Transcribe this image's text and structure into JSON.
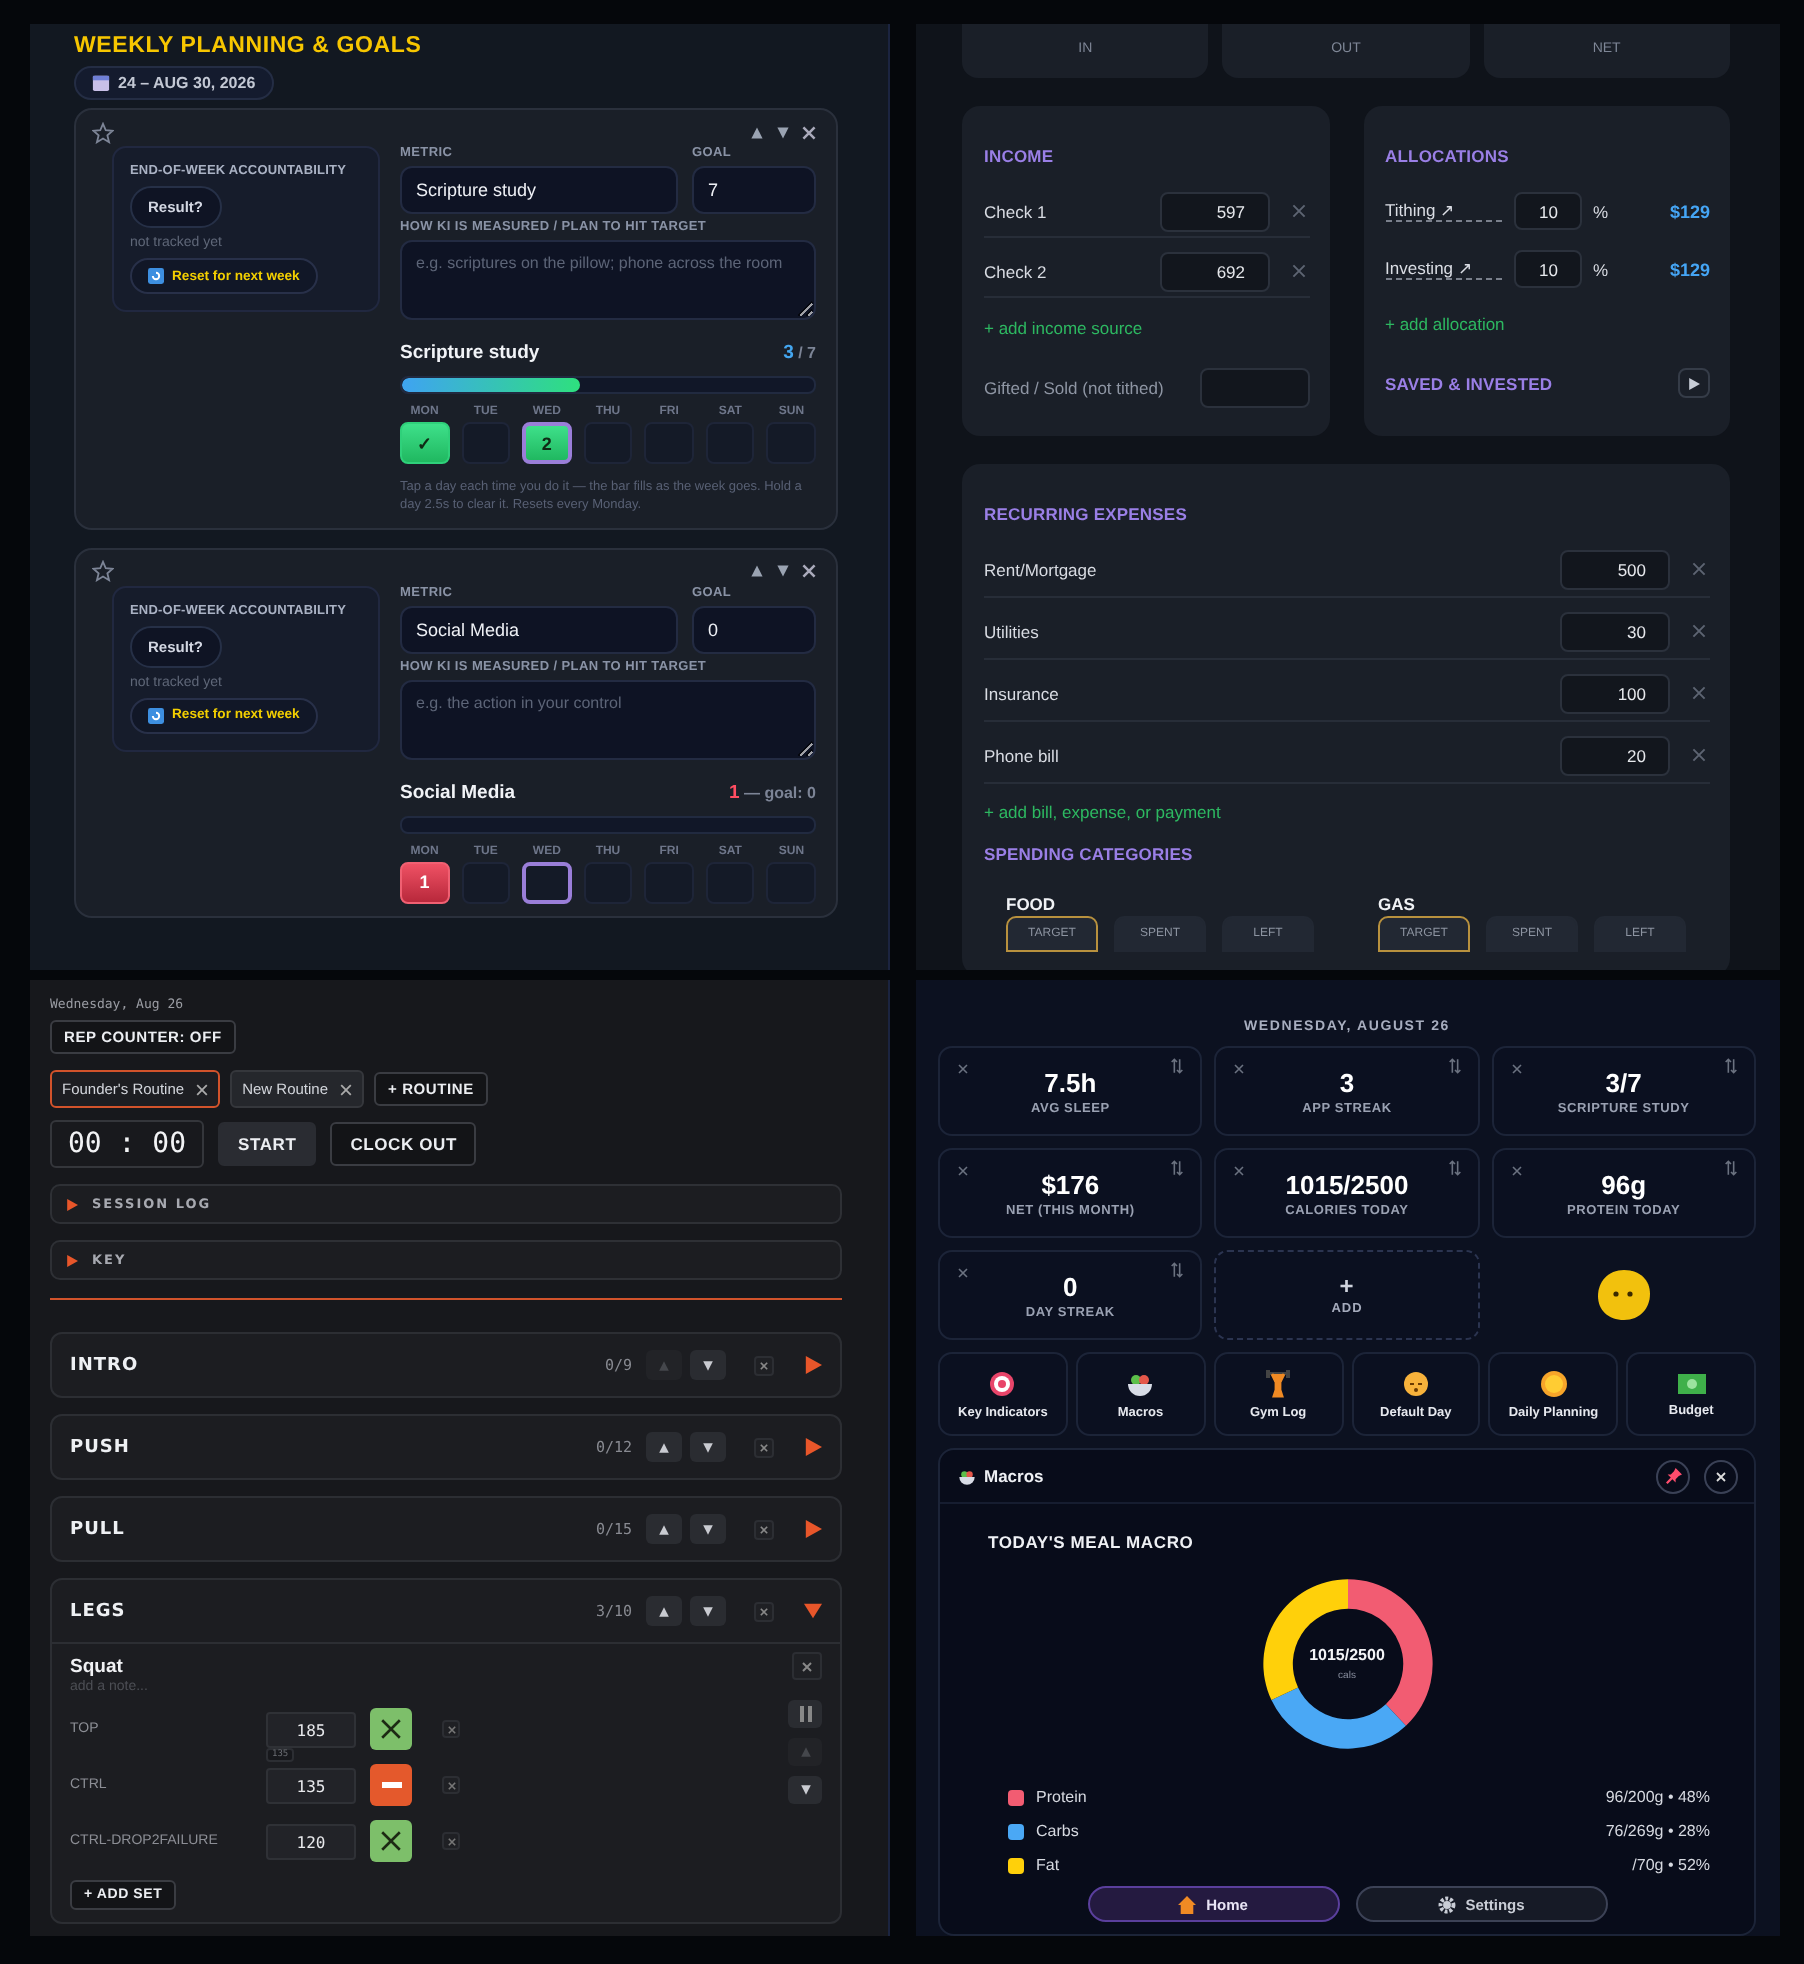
{
  "planning": {
    "title": "WEEKLY PLANNING & GOALS",
    "date_range": "24 – AUG 30, 2026",
    "goals": [
      {
        "starred": false,
        "accountability_label": "END-OF-WEEK ACCOUNTABILITY",
        "result_button": "Result?",
        "tracking_status": "not tracked yet",
        "reset_button": "Reset for next week",
        "metric_label": "METRIC",
        "metric": "Scripture study",
        "goal_label": "GOAL",
        "goal": "7",
        "plan_label": "HOW KI IS MEASURED / PLAN TO HIT TARGET",
        "plan_placeholder": "e.g. scriptures on the pillow; phone across the room",
        "progress_title": "Scripture study",
        "count": "3",
        "count_suffix": "/ 7",
        "over_goal": false,
        "level": 0.43,
        "days": [
          {
            "label": "MON",
            "mark": "✓",
            "checked": true,
            "today": false
          },
          {
            "label": "TUE",
            "checked": false,
            "today": false
          },
          {
            "label": "WED",
            "mark": "2",
            "checked": true,
            "today": true
          },
          {
            "label": "THU",
            "checked": false,
            "today": false
          },
          {
            "label": "FRI",
            "checked": false,
            "today": false
          },
          {
            "label": "SAT",
            "checked": false,
            "today": false
          },
          {
            "label": "SUN",
            "checked": false,
            "today": false
          }
        ],
        "hint": "Tap a day each time you do it — the bar fills as the week goes. Hold a day 2.5s to clear it. Resets every Monday."
      },
      {
        "starred": false,
        "accountability_label": "END-OF-WEEK ACCOUNTABILITY",
        "result_button": "Result?",
        "tracking_status": "not tracked yet",
        "reset_button": "Reset for next week",
        "metric_label": "METRIC",
        "metric": "Social Media",
        "goal_label": "GOAL",
        "goal": "0",
        "plan_label": "HOW KI IS MEASURED / PLAN TO HIT TARGET",
        "plan_placeholder": "e.g. the action in your control",
        "progress_title": "Social Media",
        "count": "1",
        "count_suffix": "— goal: 0",
        "over_goal": true,
        "level": 0,
        "days": [
          {
            "label": "MON",
            "mark": "1",
            "checked": true,
            "today": false
          },
          {
            "label": "TUE",
            "checked": false,
            "today": false
          },
          {
            "label": "WED",
            "checked": false,
            "today": true
          },
          {
            "label": "THU",
            "checked": false,
            "today": false
          },
          {
            "label": "FRI",
            "checked": false,
            "today": false
          },
          {
            "label": "SAT",
            "checked": false,
            "today": false
          },
          {
            "label": "SUN",
            "checked": false,
            "today": false
          }
        ]
      }
    ]
  },
  "budget": {
    "summary": [
      "IN",
      "OUT",
      "NET"
    ],
    "income": {
      "title": "INCOME",
      "sources": [
        {
          "name": "Check 1",
          "amount": "597"
        },
        {
          "name": "Check 2",
          "amount": "692"
        }
      ],
      "add_label": "+ add income source",
      "gifted_label": "Gifted / Sold (not tithed)"
    },
    "allocations": {
      "title": "ALLOCATIONS",
      "items": [
        {
          "name": "Tithing ↗",
          "percent": "10",
          "unit": "%",
          "amount": "$129"
        },
        {
          "name": "Investing ↗",
          "percent": "10",
          "unit": "%",
          "amount": "$129"
        }
      ],
      "add_label": "+ add allocation",
      "saved_title": "SAVED & INVESTED"
    },
    "expenses": {
      "title": "RECURRING EXPENSES",
      "items": [
        {
          "name": "Rent/Mortgage",
          "amount": "500"
        },
        {
          "name": "Utilities",
          "amount": "30"
        },
        {
          "name": "Insurance",
          "amount": "100"
        },
        {
          "name": "Phone bill",
          "amount": "20"
        }
      ],
      "add_label": "+ add bill, expense, or payment"
    },
    "spending": {
      "title": "SPENDING CATEGORIES",
      "categories": [
        {
          "name": "FOOD",
          "tabs": [
            {
              "label": "TARGET",
              "selected": true
            },
            {
              "label": "SPENT",
              "selected": false
            },
            {
              "label": "LEFT",
              "selected": false
            }
          ]
        },
        {
          "name": "GAS",
          "tabs": [
            {
              "label": "TARGET",
              "selected": true
            },
            {
              "label": "SPENT",
              "selected": false
            },
            {
              "label": "LEFT",
              "selected": false
            }
          ]
        }
      ]
    }
  },
  "gym": {
    "date": "Wednesday, Aug 26",
    "rep_counter": "REP COUNTER: OFF",
    "routines": [
      {
        "name": "Founder's Routine",
        "selected": true
      },
      {
        "name": "New Routine",
        "selected": false
      }
    ],
    "add_routine": "+ ROUTINE",
    "timer": "00 : 00",
    "start": "START",
    "clock_out": "CLOCK OUT",
    "panels": [
      "SESSION LOG",
      "KEY"
    ],
    "sections": [
      {
        "name": "INTRO",
        "progress": "0/9",
        "up_disabled": true,
        "expanded": false
      },
      {
        "name": "PUSH",
        "progress": "0/12",
        "up_disabled": false,
        "expanded": false
      },
      {
        "name": "PULL",
        "progress": "0/15",
        "up_disabled": false,
        "expanded": false
      },
      {
        "name": "LEGS",
        "progress": "3/10",
        "up_disabled": false,
        "expanded": true
      }
    ],
    "exercise": {
      "name": "Squat",
      "note_placeholder": "add a note...",
      "sets": [
        {
          "label": "TOP",
          "weight": "185",
          "previous": "135",
          "kind": "done"
        },
        {
          "label": "CTRL",
          "weight": "135",
          "kind": "partial"
        },
        {
          "label": "CTRL-DROP2FAILURE",
          "weight": "120",
          "kind": "done"
        }
      ],
      "add_set": "+ ADD SET"
    }
  },
  "dashboard": {
    "date": "WEDNESDAY, AUGUST 26",
    "stats": [
      {
        "value": "7.5h",
        "label": "AVG SLEEP"
      },
      {
        "value": "3",
        "label": "APP STREAK"
      },
      {
        "value": "3/7",
        "label": "SCRIPTURE STUDY"
      },
      {
        "value": "$176",
        "label": "NET (THIS MONTH)"
      },
      {
        "value": "1015/2500",
        "label": "CALORIES TODAY"
      },
      {
        "value": "96g",
        "label": "PROTEIN TODAY"
      },
      {
        "value": "0",
        "label": "DAY STREAK"
      }
    ],
    "add_tile": {
      "icon": "+",
      "label": "ADD"
    },
    "shortcuts": [
      {
        "label": "Key Indicators",
        "kind": "target"
      },
      {
        "label": "Macros",
        "kind": "bowl"
      },
      {
        "label": "Gym Log",
        "kind": "lifter"
      },
      {
        "label": "Default Day",
        "kind": "face"
      },
      {
        "label": "Daily Planning",
        "kind": "sun"
      },
      {
        "label": "Budget",
        "kind": "cash"
      }
    ],
    "macros": {
      "title": "Macros",
      "heading": "TODAY'S MEAL MACRO",
      "center": "1015/2500",
      "center_unit": "cals",
      "chart_data": {
        "type": "donut",
        "categories": [
          "Protein",
          "Carbs",
          "Fat"
        ],
        "values": [
          38,
          30,
          32
        ]
      },
      "legend": [
        {
          "value": "96/200g • 48%",
          "color": "#f25c72"
        },
        {
          "value": "76/269g • 28%",
          "color": "#4aa8f5"
        },
        {
          "value": "/70g • 52%",
          "color": "#ffd00a"
        }
      ]
    },
    "nav": [
      {
        "label": "Home",
        "kind": "home",
        "selected": true
      },
      {
        "label": "Settings",
        "kind": "gear",
        "selected": false
      }
    ]
  }
}
